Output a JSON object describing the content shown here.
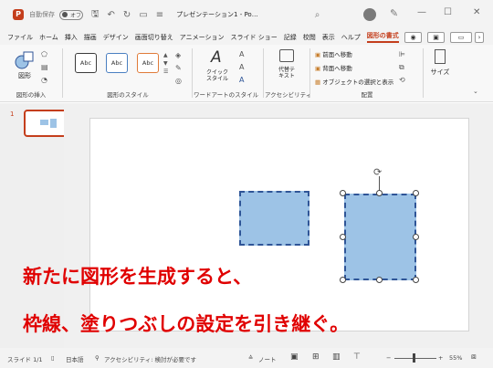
{
  "titlebar": {
    "app_icon": "P",
    "autosave_label": "自動保存",
    "autosave_state": "オフ",
    "save_icon": "save-icon",
    "undo_icon": "undo-icon",
    "redo_icon": "redo-icon",
    "customize_icon": "customize-icon",
    "doc_title": "プレゼンテーション1 - Po…",
    "search_icon": "search-icon",
    "minimize": "—",
    "maximize": "☐",
    "close": "✕"
  },
  "menu": {
    "items": [
      "ファイル",
      "ホーム",
      "挿入",
      "描画",
      "デザイン",
      "画面切り替え",
      "アニメーション",
      "スライド ショー",
      "記録",
      "校閲",
      "表示",
      "ヘルプ",
      "図形の書式"
    ],
    "active_index": 12,
    "record_btn": "◉",
    "present_btn": "▣",
    "comment_btn": "▭",
    "more_btn": "›"
  },
  "ribbon": {
    "insert_shapes": {
      "shape_btn": "図形",
      "label": "図形の挿入"
    },
    "shape_styles": {
      "samples": [
        "Abc",
        "Abc",
        "Abc"
      ],
      "label": "図形のスタイル",
      "colors": [
        "#3b3b3b",
        "#4a7fc1",
        "#e07b39"
      ]
    },
    "wordart": {
      "quick_style": "クイック\nスタイル",
      "label": "ワードアートのスタイル"
    },
    "accessibility": {
      "alt_text": "代替テ\nキスト",
      "label": "アクセシビリティ"
    },
    "arrange": {
      "bring_forward": "前面へ移動",
      "send_backward": "背面へ移動",
      "selection_pane": "オブジェクトの選択と表示",
      "label": "配置"
    },
    "size": {
      "label": "サイズ"
    }
  },
  "thumbnails": {
    "slide_number": "1"
  },
  "caption": {
    "line1": "新たに図形を生成すると、",
    "line2": "枠線、塗りつぶしの設定を引き継ぐ。"
  },
  "status": {
    "slide": "スライド 1/1",
    "language": "日本語",
    "accessibility": "アクセシビリティ: 検討が必要です",
    "notes": "ノート",
    "zoom": "55%"
  },
  "colors": {
    "accent": "#c43e1c",
    "shape_fill": "#9dc3e6",
    "shape_border": "#2f5597",
    "caption": "#e00000"
  }
}
